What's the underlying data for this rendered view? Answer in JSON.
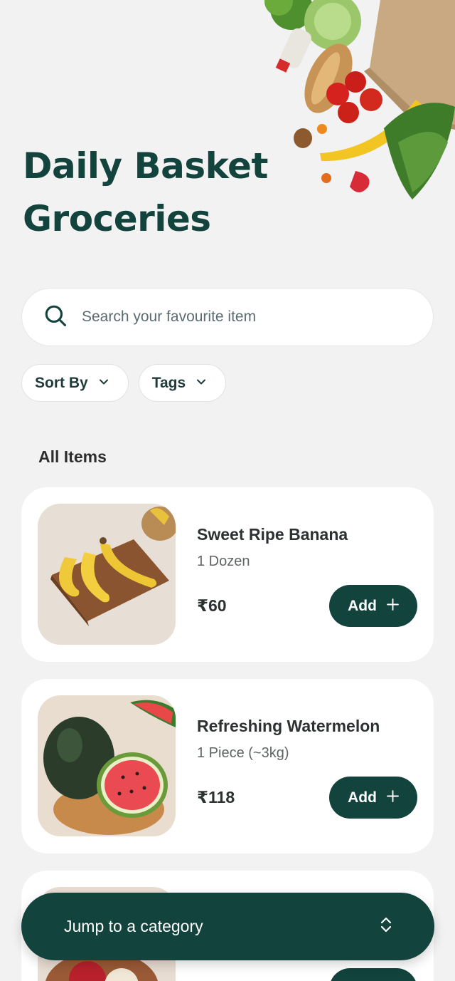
{
  "header": {
    "title_line1": "Daily Basket",
    "title_line2": "Groceries"
  },
  "search": {
    "placeholder": "Search your favourite item",
    "icon": "search-icon"
  },
  "filters": [
    {
      "label": "Sort By",
      "icon": "chevron-down-icon"
    },
    {
      "label": "Tags",
      "icon": "chevron-down-icon"
    }
  ],
  "section": {
    "title": "All Items"
  },
  "items": [
    {
      "name": "Sweet Ripe Banana",
      "quantity": "1 Dozen",
      "price": "₹60",
      "add_label": "Add",
      "image": "banana-image"
    },
    {
      "name": "Refreshing Watermelon",
      "quantity": "1 Piece (~3kg)",
      "price": "₹118",
      "add_label": "Add",
      "image": "watermelon-image"
    },
    {
      "name": "",
      "quantity": "",
      "price": "",
      "add_label": "",
      "image": "apple-image"
    }
  ],
  "jump": {
    "label": "Jump to a category",
    "icon": "chevron-up-down-icon"
  },
  "colors": {
    "brand": "#12433d",
    "background": "#f2f2f2",
    "card": "#ffffff"
  }
}
